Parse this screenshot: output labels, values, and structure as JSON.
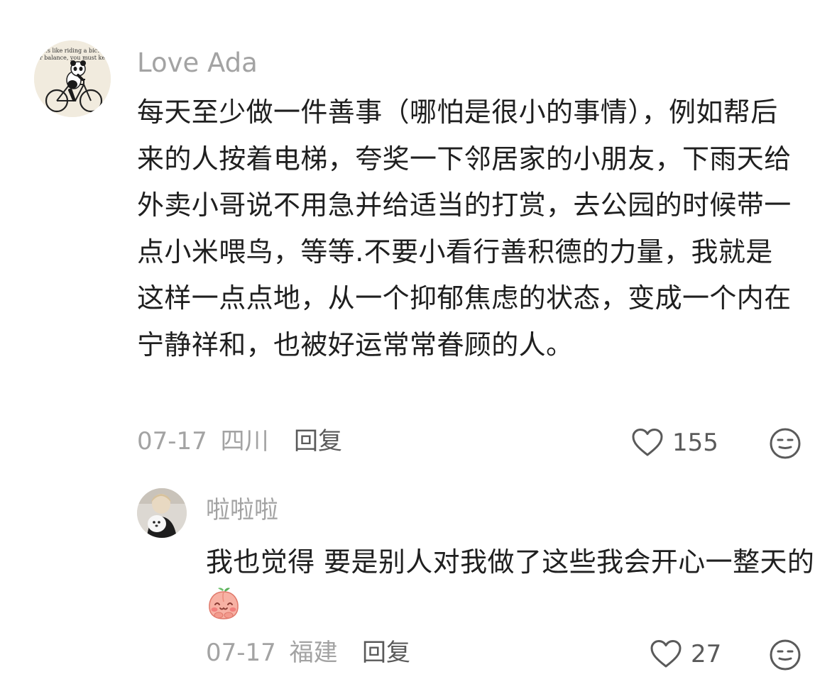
{
  "comments": [
    {
      "username": "Love Ada",
      "avatar_text_line1": "…s like riding a bic…",
      "avatar_text_line2": "…r balance, you must ke…",
      "body": "每天至少做一件善事（哪怕是很小的事情），例如帮后来的人按着电梯，夸奖一下邻居家的小朋友，下雨天给外卖小哥说不用急并给适当的打赏，去公园的时候带一点小米喂鸟，等等.不要小看行善积德的力量，我就是这样一点点地，从一个抑郁焦虑的状态，变成一个内在宁静祥和，也被好运常常眷顾的人。",
      "date": "07-17",
      "location": "四川",
      "reply_label": "回复",
      "likes": "155",
      "like_icon": "heart-outline-icon",
      "dislike_icon": "meh-face-icon"
    },
    {
      "username": "啦啦啦",
      "body": "我也觉得 要是别人对我做了这些我会开心一整天的",
      "body_emoji": "smiling-peach-emoji",
      "date": "07-17",
      "location": "福建",
      "reply_label": "回复",
      "likes": "27",
      "like_icon": "heart-outline-icon",
      "dislike_icon": "meh-face-icon"
    }
  ],
  "colors": {
    "secondary_text": "#a3a3a3",
    "primary_text": "#1f1f1f",
    "action_text": "#5a5a5a"
  }
}
